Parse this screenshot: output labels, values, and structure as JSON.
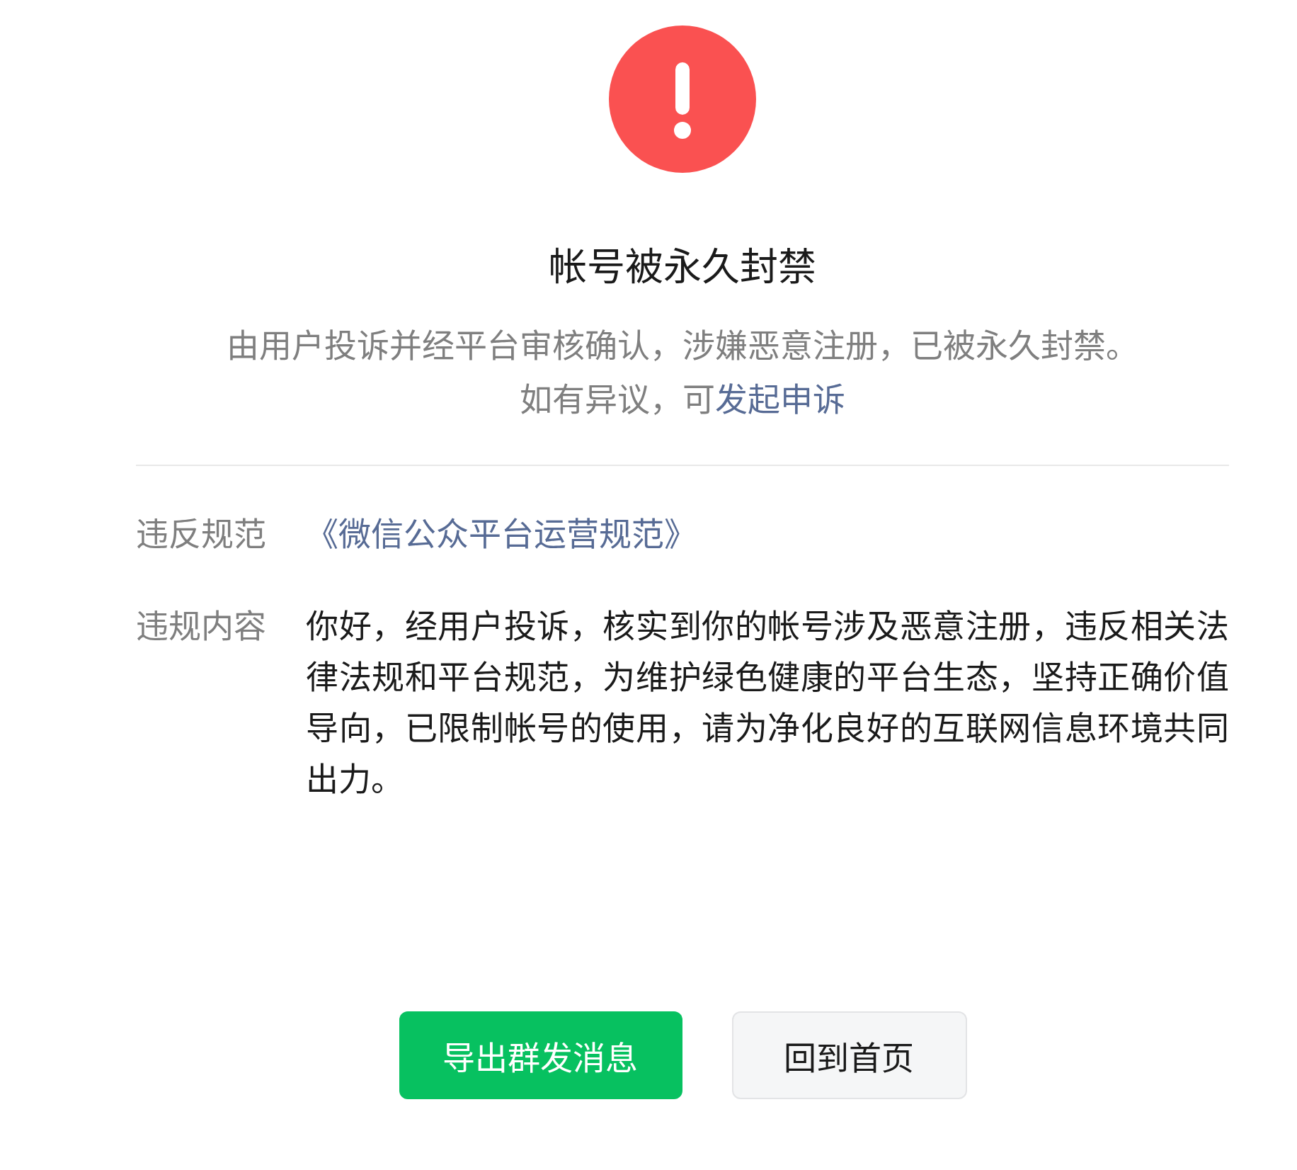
{
  "status": {
    "kind": "warning",
    "title": "帐号被永久封禁",
    "description": "由用户投诉并经平台审核确认，涉嫌恶意注册，已被永久封禁。",
    "appeal_text": "如有异议，可",
    "appeal_link": "发起申诉"
  },
  "details": [
    {
      "kind": "link",
      "label": "违反规范",
      "value": "《微信公众平台运营规范》"
    },
    {
      "kind": "text",
      "label": "违规内容",
      "value": "你好，经用户投诉，核实到你的帐号涉及恶意注册，违反相关法律法规和平台规范，为维护绿色健康的平台生态，坚持正确价值导向，已限制帐号的使用，请为净化良好的互联网信息环境共同出力。"
    }
  ],
  "buttons": [
    {
      "kind": "primary",
      "label": "导出群发消息"
    },
    {
      "kind": "default",
      "label": "回到首页"
    }
  ]
}
